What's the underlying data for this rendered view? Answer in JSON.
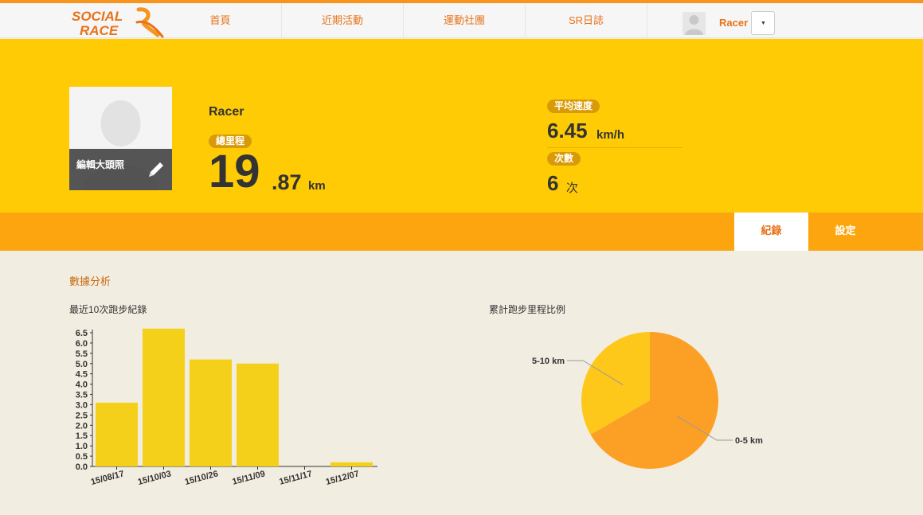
{
  "header": {
    "nav": [
      "首頁",
      "近期活動",
      "運動社團",
      "SR日誌"
    ],
    "user_name": "Racer",
    "dropdown_glyph": "▼",
    "logo_text": [
      "SOCIAL",
      "RACE"
    ]
  },
  "profile": {
    "edit_photo_label": "編輯大頭照",
    "name": "Racer",
    "total_distance_label": "總里程",
    "total_distance_int": "19",
    "total_distance_dec": ".87",
    "distance_unit": "km",
    "avg_speed_label": "平均速度",
    "avg_speed_value": "6.45",
    "avg_speed_unit": "km/h",
    "count_label": "次數",
    "count_value": "6",
    "count_unit": "次"
  },
  "tabs": [
    {
      "label": "紀錄",
      "active": true
    },
    {
      "label": "設定",
      "active": false
    }
  ],
  "analysis": {
    "section_title": "數據分析",
    "bar_title": "最近10次跑步紀錄",
    "pie_title": "累計跑步里程比例"
  },
  "chart_data": [
    {
      "type": "bar",
      "title": "最近10次跑步紀錄",
      "categories": [
        "15/08/17",
        "15/10/03",
        "15/10/26",
        "15/11/09",
        "15/11/17",
        "15/12/07"
      ],
      "values": [
        3.1,
        6.7,
        5.2,
        5.0,
        0.0,
        0.2
      ],
      "ylim": [
        0,
        6.5
      ],
      "yticks": [
        "0.0",
        "0.5",
        "1.0",
        "1.5",
        "2.0",
        "2.5",
        "3.0",
        "3.5",
        "4.0",
        "4.5",
        "5.0",
        "5.5",
        "6.0",
        "6.5"
      ],
      "color": "#f5d01b"
    },
    {
      "type": "pie",
      "title": "累計跑步里程比例",
      "labels": [
        "0-5 km",
        "5-10 km"
      ],
      "values": [
        2,
        1
      ],
      "colors": [
        "#fca025",
        "#fdc81a"
      ]
    }
  ],
  "colors": {
    "accent_orange": "#e8731a",
    "banner_yellow": "#ffcb05",
    "tabbar_orange": "#fda50f",
    "pill_brown": "#d99a08",
    "page_bg": "#f2ede1"
  }
}
